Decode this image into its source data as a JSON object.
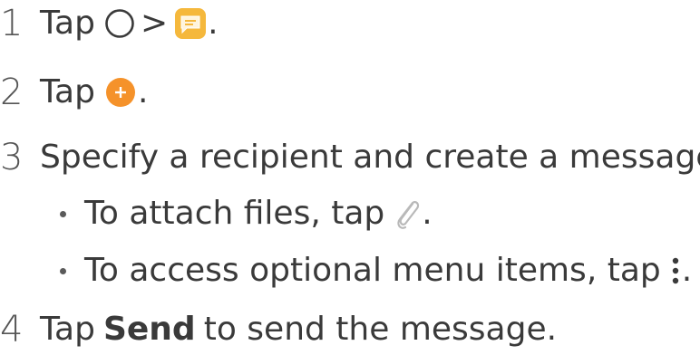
{
  "steps": [
    {
      "num": "1",
      "text_before": "Tap",
      "sep": ">",
      "text_after": "."
    },
    {
      "num": "2",
      "text_before": "Tap",
      "text_after": "."
    },
    {
      "num": "3",
      "text": "Specify a recipient and create a message."
    },
    {
      "num": "4",
      "text_before": "Tap",
      "bold": "Send",
      "text_after": "to send the message."
    }
  ],
  "bullets": [
    {
      "text_before": "To attach files, tap",
      "text_after": "."
    },
    {
      "text_before": "To access optional menu items, tap",
      "text_after": "."
    }
  ],
  "icons": {
    "home": "home-circle-icon",
    "messaging": "messaging-app-icon",
    "new_message": "new-message-plus-icon",
    "attach": "paperclip-icon",
    "menu": "more-options-icon"
  },
  "colors": {
    "messaging": "#f5b83c",
    "new_message": "#f5922a",
    "text": "#3a3a3a"
  }
}
